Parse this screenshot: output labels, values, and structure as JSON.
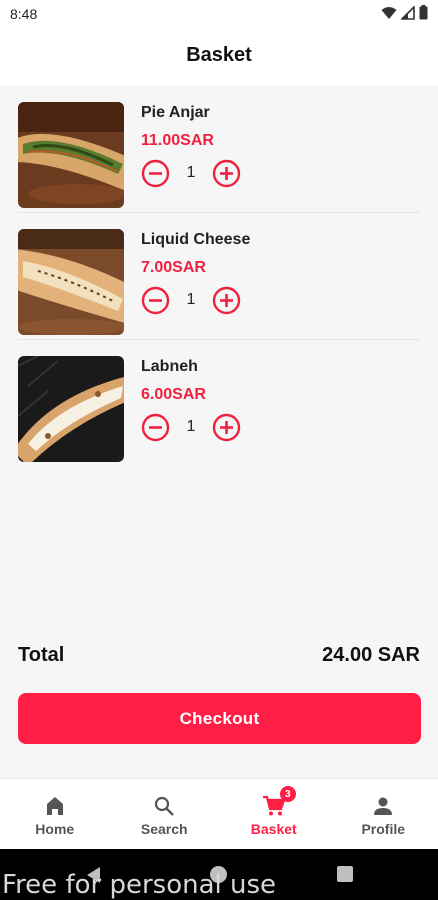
{
  "status_bar": {
    "time": "8:48",
    "icons": [
      "wifi-icon",
      "signal-icon",
      "battery-icon"
    ]
  },
  "header": {
    "title": "Basket"
  },
  "items": [
    {
      "name": "Pie Anjar",
      "price": "11.00SAR",
      "quantity": "1",
      "image": "pie-anjar-image"
    },
    {
      "name": "Liquid Cheese",
      "price": "7.00SAR",
      "quantity": "1",
      "image": "liquid-cheese-image"
    },
    {
      "name": "Labneh",
      "price": "6.00SAR",
      "quantity": "1",
      "image": "labneh-image"
    }
  ],
  "summary": {
    "total_label": "Total",
    "total_value": "24.00 SAR"
  },
  "checkout": {
    "label": "Checkout"
  },
  "bottom_nav": {
    "items": [
      {
        "label": "Home",
        "icon": "home-icon"
      },
      {
        "label": "Search",
        "icon": "search-icon"
      },
      {
        "label": "Basket",
        "icon": "cart-icon",
        "badge": "3",
        "active": true
      },
      {
        "label": "Profile",
        "icon": "person-icon"
      }
    ]
  },
  "watermark": "Free for personal use",
  "colors": {
    "accent": "#ff1e45",
    "price": "#f0213f",
    "background": "#f6f6f6"
  }
}
